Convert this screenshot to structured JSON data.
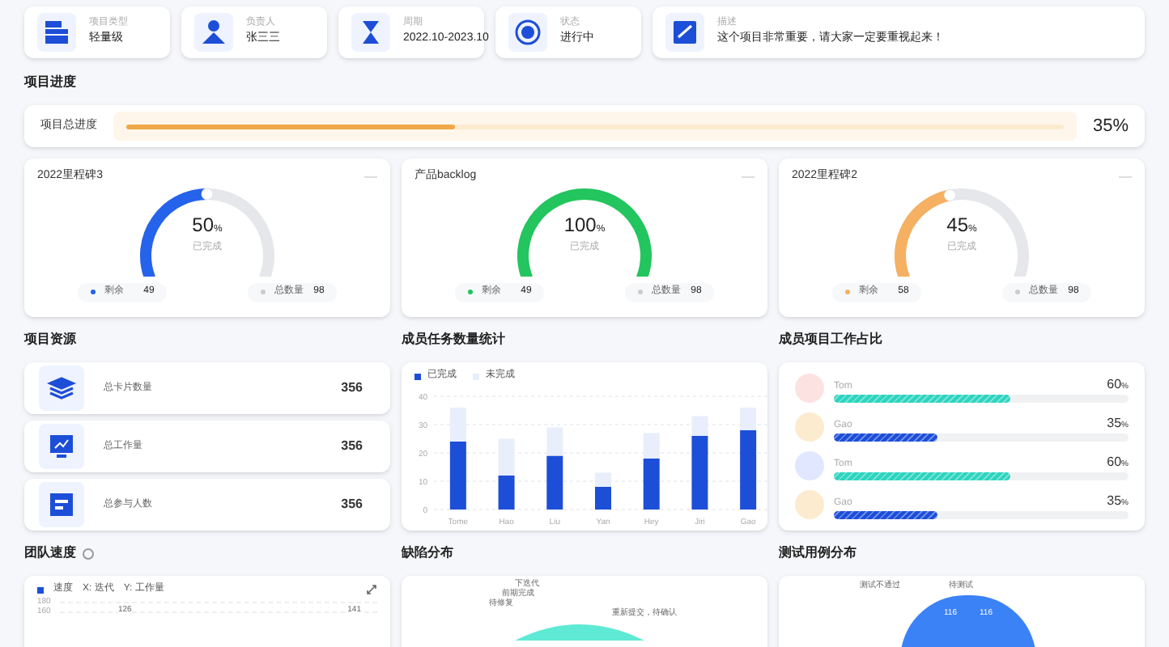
{
  "info_cards": [
    {
      "kind": "type",
      "label": "项目类型",
      "value": "轻量级"
    },
    {
      "kind": "owner",
      "label": "负责人",
      "value": "张三三"
    },
    {
      "kind": "period",
      "label": "周期",
      "value": "2022.10-2023.10"
    },
    {
      "kind": "status",
      "label": "状态",
      "value": "进行中"
    },
    {
      "kind": "note",
      "label": "描述",
      "value": "这个项目非常重要，请大家一定要重视起来！"
    }
  ],
  "progress": {
    "title": "项目进度",
    "label": "项目总进度",
    "level": 0.35,
    "reading": "35%"
  },
  "gauges": [
    {
      "title": "2022里程碑3",
      "level": 0.5,
      "percent": "50",
      "unit": "%",
      "caption": "已完成",
      "color": "#2563eb",
      "remain_label": "剩余",
      "remain": "49",
      "total_label": "总数量",
      "total": "98"
    },
    {
      "title": "产品backlog",
      "level": 1,
      "percent": "100",
      "unit": "%",
      "caption": "已完成",
      "color": "#22c55e",
      "remain_label": "剩余",
      "remain": "49",
      "total_label": "总数量",
      "total": "98"
    },
    {
      "title": "2022里程碑2",
      "level": 0.45,
      "percent": "45",
      "unit": "%",
      "caption": "已完成",
      "color": "#f5b061",
      "remain_label": "剩余",
      "remain": "58",
      "total_label": "总数量",
      "total": "98"
    }
  ],
  "resources": {
    "title": "项目资源",
    "items": [
      {
        "kind": "cards",
        "label": "总卡片数量",
        "value": "356"
      },
      {
        "kind": "work",
        "label": "总工作量",
        "value": "356"
      },
      {
        "kind": "people",
        "label": "总参与人数",
        "value": "356"
      }
    ]
  },
  "task_stats": {
    "title": "成员任务数量统计",
    "chart_data": {
      "type": "bar",
      "stacked": true,
      "grid": true,
      "categories": [
        "Tome",
        "Hao",
        "Liu",
        "Yan",
        "Hey",
        "Jiri",
        "Gao"
      ],
      "yticks": [
        0,
        10,
        20,
        30,
        40
      ],
      "ylim": [
        0,
        40
      ],
      "series": [
        {
          "name": "已完成",
          "color": "#1d4ed8",
          "values": [
            24,
            12,
            19,
            8,
            18,
            26,
            28
          ]
        },
        {
          "name": "未完成",
          "color": "#e8eefb",
          "values": [
            12,
            13,
            10,
            5,
            9,
            7,
            8
          ]
        }
      ]
    }
  },
  "member_share": {
    "title": "成员项目工作占比",
    "members": [
      {
        "name": "Tom",
        "level": 0.6,
        "reading": "60",
        "unit": "%",
        "color": "#2dd4bf"
      },
      {
        "name": "Gao",
        "level": 0.35,
        "reading": "35",
        "unit": "%",
        "color": "#1d4ed8"
      },
      {
        "name": "Tom",
        "level": 0.6,
        "reading": "60",
        "unit": "%",
        "color": "#2dd4bf"
      },
      {
        "name": "Gao",
        "level": 0.35,
        "reading": "35",
        "unit": "%",
        "color": "#1d4ed8"
      }
    ]
  },
  "velocity": {
    "title": "团队速度",
    "legend": "速度",
    "x_label": "X: 迭代",
    "y_label": "Y: 工作量",
    "tick_labels": [
      "180",
      "160"
    ],
    "value_labels": [
      "126",
      "141"
    ]
  },
  "defects": {
    "title": "缺陷分布",
    "labels": [
      "下迭代",
      "前期完成",
      "待修复",
      "重新提交，待确认"
    ]
  },
  "test_cases": {
    "title": "测试用例分布",
    "labels": [
      "测试不通过",
      "待测试"
    ],
    "value_labels": [
      "116",
      "116"
    ]
  }
}
